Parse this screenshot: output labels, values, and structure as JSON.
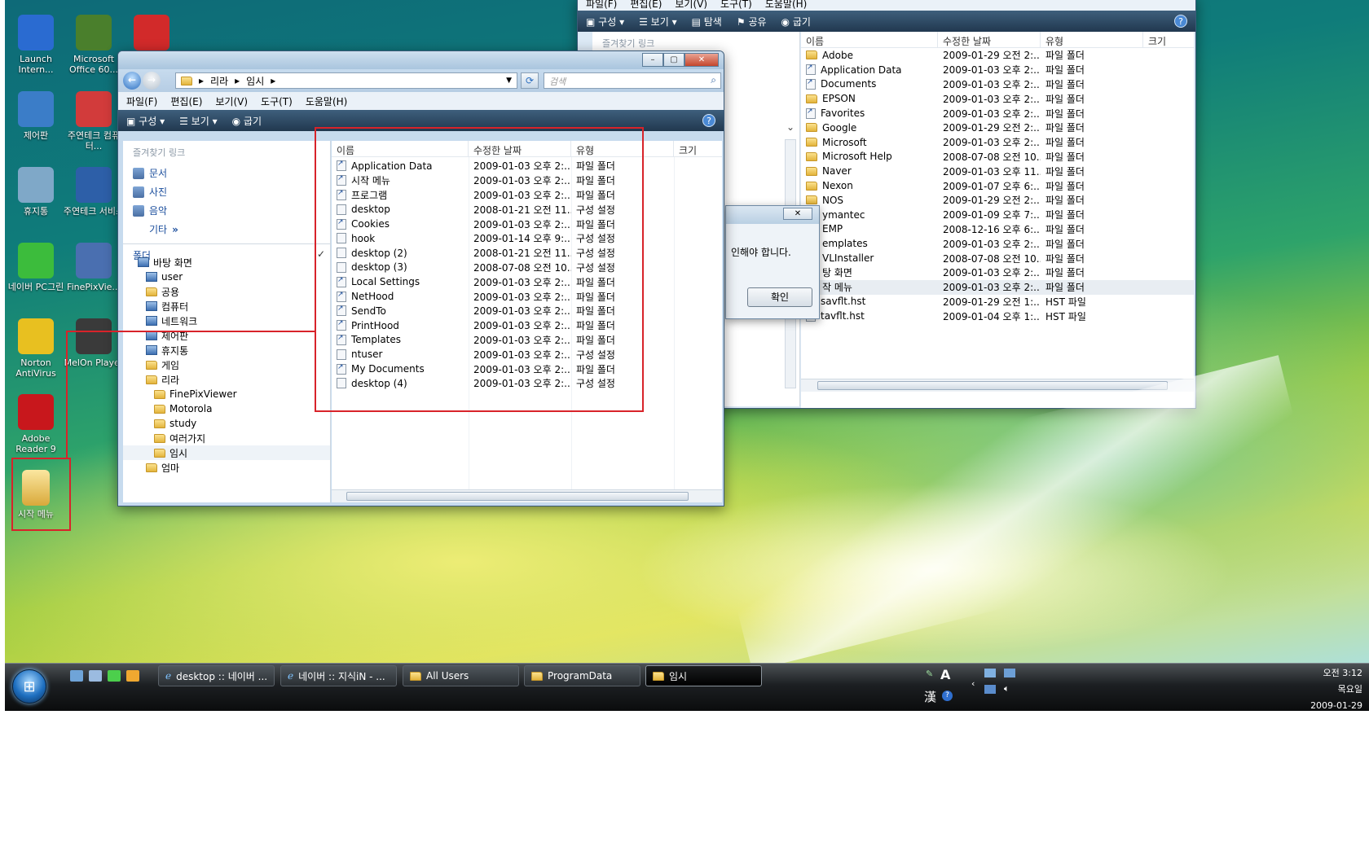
{
  "desktop_icons": [
    {
      "label": "Launch Intern...",
      "icon": "ie-icon",
      "color": "#2a6bd1"
    },
    {
      "label": "Microsoft Office 60...",
      "icon": "office-icon",
      "color": "#4a7f2c"
    },
    {
      "label": "",
      "icon": "camera-app-icon",
      "color": "#d22a2a"
    },
    {
      "label": "제어판",
      "icon": "control-panel-icon",
      "color": "#3b7dc8"
    },
    {
      "label": "주연테크 컴퓨터...",
      "icon": "help-icon",
      "color": "#d23b3b"
    },
    {
      "label": "휴지통",
      "icon": "recycle-bin-icon",
      "color": "#7fa8c8"
    },
    {
      "label": "주연테크 서비스",
      "icon": "service-icon",
      "color": "#2d5fa8"
    },
    {
      "label": "네이버 PC그린",
      "icon": "pcgreen-icon",
      "color": "#3cbc3c"
    },
    {
      "label": "FinePixVie...",
      "icon": "finepix-icon",
      "color": "#4a6fb0"
    },
    {
      "label": "Norton AntiVirus",
      "icon": "norton-icon",
      "color": "#e8c020"
    },
    {
      "label": "MelOn Player",
      "icon": "melon-icon",
      "color": "#3a3a3a"
    },
    {
      "label": "Adobe Reader 9",
      "icon": "adobe-reader-icon",
      "color": "#c8171c"
    },
    {
      "label": "시작 메뉴",
      "icon": "folder-icon",
      "color": "#e8c050"
    }
  ],
  "front_window": {
    "address": [
      "리라",
      "임시"
    ],
    "search_placeholder": "검색",
    "menu": [
      "파일(F)",
      "편집(E)",
      "보기(V)",
      "도구(T)",
      "도움말(H)"
    ],
    "toolbar": [
      "구성",
      "보기",
      "굽기"
    ],
    "favorites_label": "즐겨찾기 링크",
    "favorites": [
      "문서",
      "사진",
      "음악"
    ],
    "more_label": "기타",
    "folders_label": "폴더",
    "tree": [
      {
        "label": "바탕 화면",
        "level": 0,
        "kind": "sys"
      },
      {
        "label": "user",
        "level": 1,
        "kind": "sys"
      },
      {
        "label": "공용",
        "level": 1,
        "kind": "folder"
      },
      {
        "label": "컴퓨터",
        "level": 1,
        "kind": "sys"
      },
      {
        "label": "네트워크",
        "level": 1,
        "kind": "sys"
      },
      {
        "label": "제어판",
        "level": 1,
        "kind": "sys"
      },
      {
        "label": "휴지통",
        "level": 1,
        "kind": "sys"
      },
      {
        "label": "게임",
        "level": 1,
        "kind": "folder"
      },
      {
        "label": "리라",
        "level": 1,
        "kind": "folder"
      },
      {
        "label": "FinePixViewer",
        "level": 2,
        "kind": "folder"
      },
      {
        "label": "Motorola",
        "level": 2,
        "kind": "folder"
      },
      {
        "label": "study",
        "level": 2,
        "kind": "folder"
      },
      {
        "label": "여러가지",
        "level": 2,
        "kind": "folder"
      },
      {
        "label": "임시",
        "level": 2,
        "kind": "folder"
      },
      {
        "label": "엄마",
        "level": 1,
        "kind": "folder"
      }
    ],
    "columns": [
      "이름",
      "수정한 날짜",
      "유형",
      "크기"
    ],
    "rows": [
      {
        "name": "Application Data",
        "date": "2009-01-03 오후 2:...",
        "type": "파일 폴더",
        "kind": "link"
      },
      {
        "name": "시작 메뉴",
        "date": "2009-01-03 오후 2:...",
        "type": "파일 폴더",
        "kind": "link"
      },
      {
        "name": "프로그램",
        "date": "2009-01-03 오후 2:...",
        "type": "파일 폴더",
        "kind": "link"
      },
      {
        "name": "desktop",
        "date": "2008-01-21 오전 11...",
        "type": "구성 설정",
        "kind": "file"
      },
      {
        "name": "Cookies",
        "date": "2009-01-03 오후 2:...",
        "type": "파일 폴더",
        "kind": "link"
      },
      {
        "name": "hook",
        "date": "2009-01-14 오후 9:...",
        "type": "구성 설정",
        "kind": "file"
      },
      {
        "name": "desktop (2)",
        "date": "2008-01-21 오전 11...",
        "type": "구성 설정",
        "kind": "file"
      },
      {
        "name": "desktop (3)",
        "date": "2008-07-08 오전 10...",
        "type": "구성 설정",
        "kind": "file"
      },
      {
        "name": "Local Settings",
        "date": "2009-01-03 오후 2:...",
        "type": "파일 폴더",
        "kind": "link"
      },
      {
        "name": "NetHood",
        "date": "2009-01-03 오후 2:...",
        "type": "파일 폴더",
        "kind": "link"
      },
      {
        "name": "SendTo",
        "date": "2009-01-03 오후 2:...",
        "type": "파일 폴더",
        "kind": "link"
      },
      {
        "name": "PrintHood",
        "date": "2009-01-03 오후 2:...",
        "type": "파일 폴더",
        "kind": "link"
      },
      {
        "name": "Templates",
        "date": "2009-01-03 오후 2:...",
        "type": "파일 폴더",
        "kind": "link"
      },
      {
        "name": "ntuser",
        "date": "2009-01-03 오후 2:...",
        "type": "구성 설정",
        "kind": "file"
      },
      {
        "name": "My Documents",
        "date": "2009-01-03 오후 2:...",
        "type": "파일 폴더",
        "kind": "link"
      },
      {
        "name": "desktop (4)",
        "date": "2009-01-03 오후 2:...",
        "type": "구성 설정",
        "kind": "file"
      }
    ]
  },
  "back_window": {
    "menu": [
      "파일(F)",
      "편집(E)",
      "보기(V)",
      "도구(T)",
      "도움말(H)"
    ],
    "toolbar": [
      "구성",
      "보기",
      "탐색",
      "공유",
      "굽기"
    ],
    "favorites_label": "즐겨찾기 링크",
    "columns": [
      "이름",
      "수정한 날짜",
      "유형",
      "크기"
    ],
    "rows": [
      {
        "name": "Adobe",
        "date": "2009-01-29 오전 2:...",
        "type": "파일 폴더",
        "kind": "folder"
      },
      {
        "name": "Application Data",
        "date": "2009-01-03 오후 2:...",
        "type": "파일 폴더",
        "kind": "link"
      },
      {
        "name": "Documents",
        "date": "2009-01-03 오후 2:...",
        "type": "파일 폴더",
        "kind": "link"
      },
      {
        "name": "EPSON",
        "date": "2009-01-03 오후 2:...",
        "type": "파일 폴더",
        "kind": "folder"
      },
      {
        "name": "Favorites",
        "date": "2009-01-03 오후 2:...",
        "type": "파일 폴더",
        "kind": "link"
      },
      {
        "name": "Google",
        "date": "2009-01-29 오전 2:...",
        "type": "파일 폴더",
        "kind": "folder"
      },
      {
        "name": "Microsoft",
        "date": "2009-01-03 오후 2:...",
        "type": "파일 폴더",
        "kind": "folder"
      },
      {
        "name": "Microsoft Help",
        "date": "2008-07-08 오전 10...",
        "type": "파일 폴더",
        "kind": "folder"
      },
      {
        "name": "Naver",
        "date": "2009-01-03 오후 11...",
        "type": "파일 폴더",
        "kind": "folder"
      },
      {
        "name": "Nexon",
        "date": "2009-01-07 오후 6:...",
        "type": "파일 폴더",
        "kind": "folder"
      },
      {
        "name": "NOS",
        "date": "2009-01-29 오전 2:...",
        "type": "파일 폴더",
        "kind": "folder"
      },
      {
        "name": "ymantec",
        "date": "2009-01-09 오후 7:...",
        "type": "파일 폴더",
        "kind": "folder"
      },
      {
        "name": "EMP",
        "date": "2008-12-16 오후 6:...",
        "type": "파일 폴더",
        "kind": "folder"
      },
      {
        "name": "emplates",
        "date": "2009-01-03 오후 2:...",
        "type": "파일 폴더",
        "kind": "folder"
      },
      {
        "name": "VLInstaller",
        "date": "2008-07-08 오전 10...",
        "type": "파일 폴더",
        "kind": "folder"
      },
      {
        "name": "탕 화면",
        "date": "2009-01-03 오후 2:...",
        "type": "파일 폴더",
        "kind": "folder"
      },
      {
        "name": "작 메뉴",
        "date": "2009-01-03 오후 2:...",
        "type": "파일 폴더",
        "kind": "folder"
      },
      {
        "name": "savflt.hst",
        "date": "2009-01-29 오전 1:...",
        "type": "HST 파일",
        "kind": "file"
      },
      {
        "name": "tavflt.hst",
        "date": "2009-01-04 오후 1:...",
        "type": "HST 파일",
        "kind": "file"
      }
    ]
  },
  "dialog": {
    "message": "인해야 합니다.",
    "ok_label": "확인"
  },
  "taskbar": {
    "buttons": [
      {
        "label": "desktop :: 네이버 ..."
      },
      {
        "label": "네이버 :: 지식iN - ..."
      },
      {
        "label": "All Users"
      },
      {
        "label": "ProgramData"
      },
      {
        "label": "임시"
      }
    ],
    "ime_label": "A",
    "hanja_label": "漢",
    "time": "오전 3:12",
    "weekday": "목요일",
    "date": "2009-01-29"
  },
  "annotation_color": "#d8232a"
}
